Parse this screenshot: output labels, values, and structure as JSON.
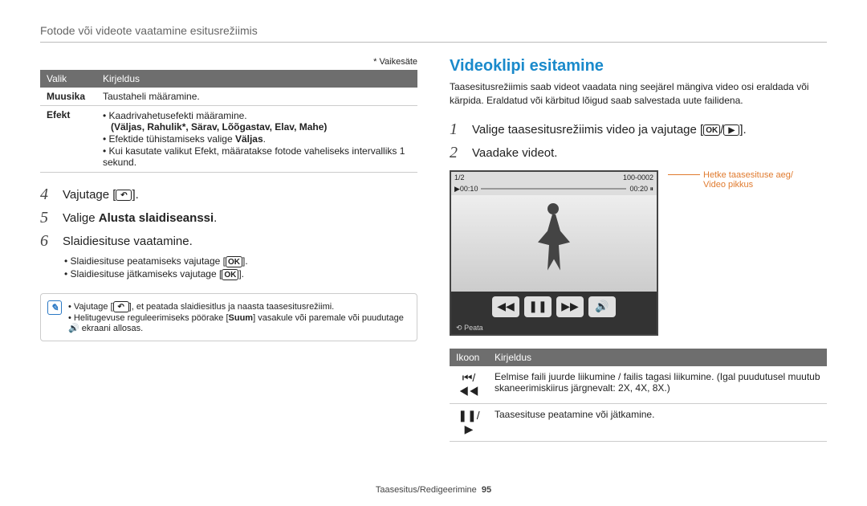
{
  "header": {
    "title": "Fotode või videote vaatamine esitusrežiimis"
  },
  "left": {
    "default_note": "* Vaikesäte",
    "table": {
      "headers": {
        "option": "Valik",
        "description": "Kirjeldus"
      },
      "rows": {
        "music": {
          "label": "Muusika",
          "desc": "Taustaheli määramine."
        },
        "effect": {
          "label": "Efekt",
          "b1": "Kaadrivahetusefekti määramine.",
          "b1_strong": "(Väljas, Rahulik*, Särav, Lõõgastav, Elav, Mahe)",
          "b2_a": "Efektide tühistamiseks valige ",
          "b2_b": "Väljas",
          "b2_c": ".",
          "b3": "Kui kasutate valikut Efekt, määratakse fotode vaheliseks intervalliks 1 sekund."
        }
      }
    },
    "steps": {
      "s4": {
        "num": "4",
        "text_a": "Vajutage [",
        "glyph": "↶",
        "text_b": "]."
      },
      "s5": {
        "num": "5",
        "text_a": "Valige ",
        "strong": "Alusta slaidiseanssi",
        "text_b": "."
      },
      "s6": {
        "num": "6",
        "text": "Slaidiesituse vaatamine."
      },
      "sub": {
        "a": "Slaidiesituse peatamiseks vajutage [",
        "a_glyph": "OK",
        "a_end": "].",
        "b": "Slaidiesituse jätkamiseks vajutage [",
        "b_glyph": "OK",
        "b_end": "]."
      }
    },
    "info": {
      "i1_a": "Vajutage [",
      "i1_glyph": "↶",
      "i1_b": "], et peatada slaidiesitlus ja naasta taasesitusrežiimi.",
      "i2_a": "Helitugevuse reguleerimiseks pöörake [",
      "i2_strong": "Suum",
      "i2_b": "] vasakule või paremale või puudutage ",
      "i2_glyph": "🔊",
      "i2_c": " ekraani allosas."
    }
  },
  "right": {
    "title": "Videoklipi esitamine",
    "para": "Taasesitusrežiimis saab videot vaadata ning seejärel mängiva video osi eraldada või kärpida. Eraldatud või kärbitud lõigud saab salvestada uute failidena.",
    "steps": {
      "s1": {
        "num": "1",
        "text_a": "Valige taasesitusrežiimis video ja vajutage [",
        "g1": "OK",
        "slash": "/",
        "g2": "▶",
        "text_b": "]."
      },
      "s2": {
        "num": "2",
        "text": "Vaadake videot."
      }
    },
    "video": {
      "counter": "1/2",
      "time_left": "▶00:10",
      "time_right": "00:20 ⏸",
      "battery": "100-0002",
      "footer_icon": "⟲",
      "footer_text": "Peata",
      "callout1": "Hetke taasesituse aeg/",
      "callout2": "Video pikkus"
    },
    "icon_table": {
      "headers": {
        "icon": "Ikoon",
        "desc": "Kirjeldus"
      },
      "row1": {
        "icon": "⏮/◀◀",
        "desc": "Eelmise faili juurde liikumine / failis tagasi liikumine. (Igal puudutusel muutub skaneerimiskiirus järgnevalt: 2X, 4X, 8X.)"
      },
      "row2": {
        "icon": "❚❚/▶",
        "desc": "Taasesituse peatamine või jätkamine."
      }
    }
  },
  "footer": {
    "section": "Taasesitus/Redigeerimine",
    "page": "95"
  }
}
